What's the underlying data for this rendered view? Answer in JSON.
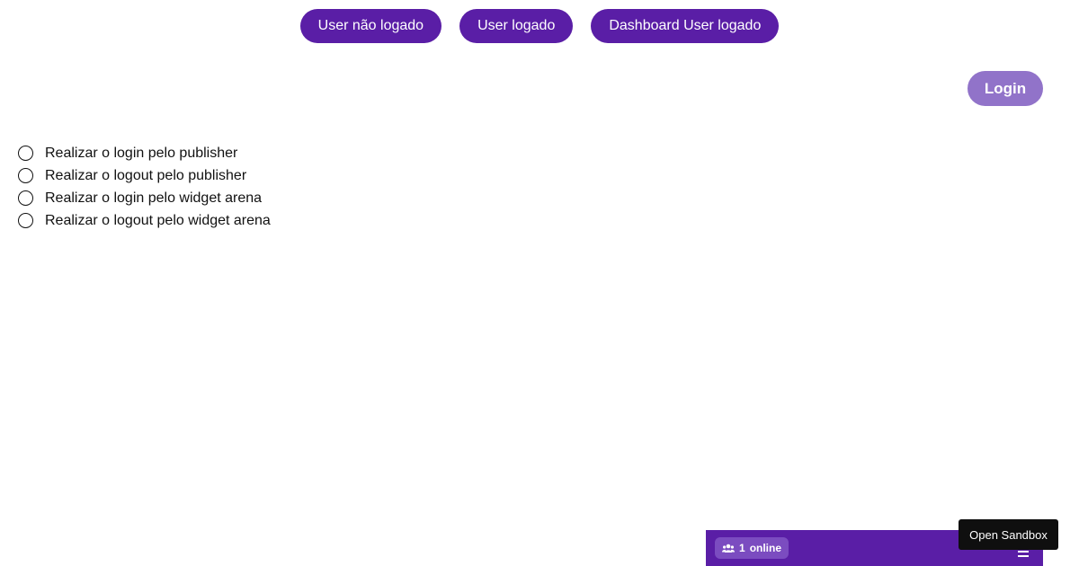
{
  "nav": {
    "buttons": [
      {
        "label": "User não logado"
      },
      {
        "label": "User logado"
      },
      {
        "label": "Dashboard User logado"
      }
    ]
  },
  "auth": {
    "login_label": "Login"
  },
  "options": [
    {
      "label": "Realizar o login pelo publisher",
      "checked": false
    },
    {
      "label": "Realizar o logout pelo publisher",
      "checked": false
    },
    {
      "label": "Realizar o login pelo widget arena",
      "checked": false
    },
    {
      "label": "Realizar o logout pelo widget arena",
      "checked": false
    }
  ],
  "widget": {
    "online_count": "1",
    "online_label": "online",
    "icons": {
      "users": "users-icon",
      "menu": "menu-icon"
    }
  },
  "sandbox": {
    "label": "Open Sandbox"
  },
  "colors": {
    "primary": "#5a1ea6",
    "login_button": "#9173c9",
    "sandbox_button": "#0f0f0f"
  }
}
